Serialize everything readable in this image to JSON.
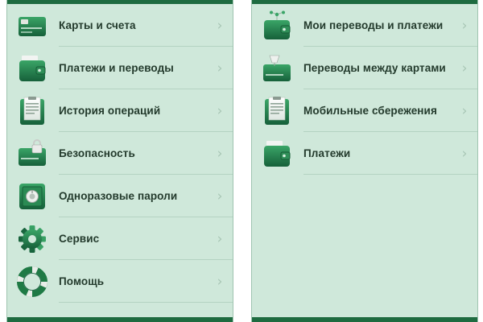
{
  "left_menu": {
    "items": [
      {
        "label": "Карты и счета",
        "icon": "card-icon"
      },
      {
        "label": "Платежи и переводы",
        "icon": "wallet-icon"
      },
      {
        "label": "История операций",
        "icon": "receipt-history-icon"
      },
      {
        "label": "Безопасность",
        "icon": "card-lock-icon"
      },
      {
        "label": "Одноразовые пароли",
        "icon": "safe-icon"
      },
      {
        "label": "Сервис",
        "icon": "gear-icon"
      },
      {
        "label": "Помощь",
        "icon": "lifebuoy-icon"
      }
    ]
  },
  "right_menu": {
    "items": [
      {
        "label": "Мои переводы и платежи",
        "icon": "wallet-network-icon"
      },
      {
        "label": "Переводы между картами",
        "icon": "card-transfer-icon"
      },
      {
        "label": "Мобильные сбережения",
        "icon": "receipt-savings-icon"
      },
      {
        "label": "Платежи",
        "icon": "wallet-icon"
      }
    ]
  },
  "chevron": "›",
  "colors": {
    "panel_bg": "#cfe8da",
    "bar": "#1e6b40",
    "icon_green": "#1f7a45",
    "text": "#233a2c"
  }
}
